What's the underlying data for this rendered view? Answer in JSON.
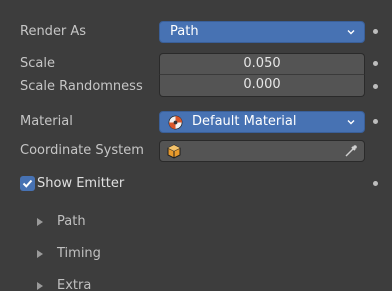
{
  "properties": {
    "render_as": {
      "label": "Render As",
      "value": "Path"
    },
    "scale": {
      "label": "Scale",
      "value": "0.050"
    },
    "scale_randomness": {
      "label": "Scale Randomness",
      "value": "0.000"
    },
    "material": {
      "label": "Material",
      "value": "Default Material",
      "icon": "material-sphere-icon"
    },
    "coordinate_system": {
      "label": "Coordinate System",
      "value": "",
      "icon": "object-cube-icon",
      "picker_icon": "eyedropper-icon"
    },
    "show_emitter": {
      "label": "Show Emitter",
      "checked": true
    }
  },
  "subpanels": [
    {
      "label": "Path",
      "expanded": false
    },
    {
      "label": "Timing",
      "expanded": false
    },
    {
      "label": "Extra",
      "expanded": false
    }
  ],
  "colors": {
    "background": "#3d3d3d",
    "accent": "#4772b3",
    "field": "#545454"
  }
}
